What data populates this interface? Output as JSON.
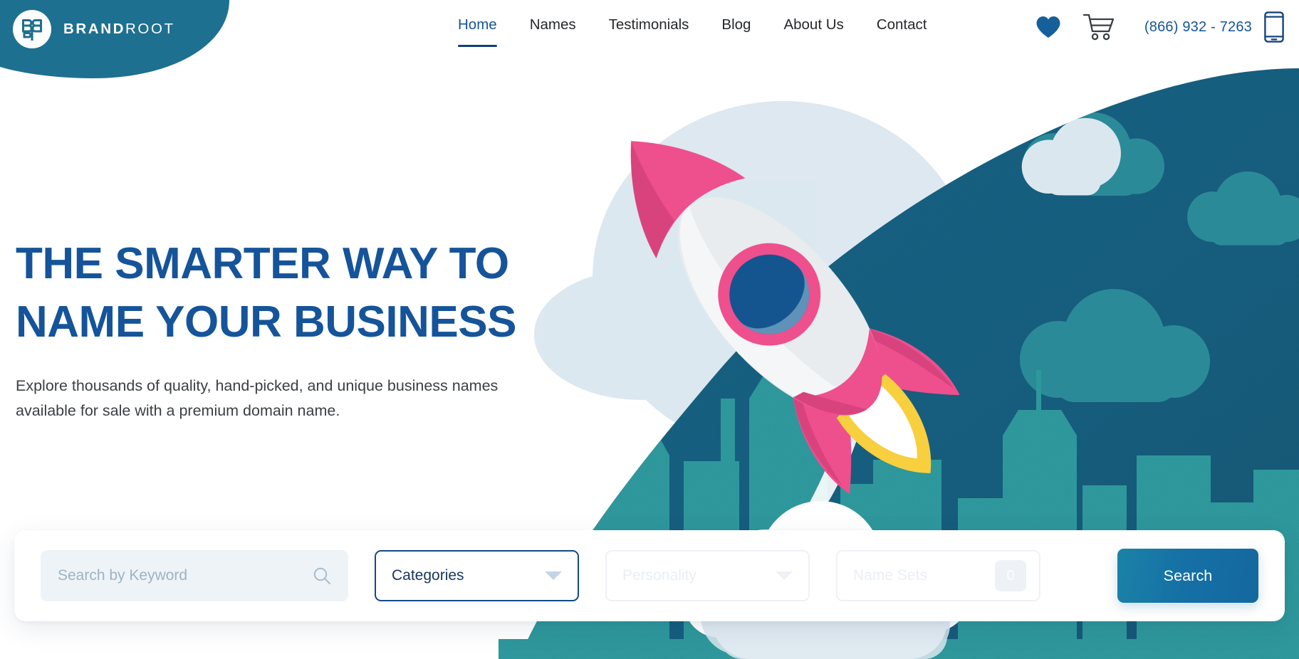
{
  "brand": {
    "name_bold": "BRAND",
    "name_light": "ROOT",
    "logo_icon": "brandroot-monogram-icon"
  },
  "nav": {
    "items": [
      {
        "label": "Home",
        "active": true
      },
      {
        "label": "Names",
        "active": false
      },
      {
        "label": "Testimonials",
        "active": false
      },
      {
        "label": "Blog",
        "active": false
      },
      {
        "label": "About Us",
        "active": false
      },
      {
        "label": "Contact",
        "active": false
      }
    ]
  },
  "header_actions": {
    "favorites_icon": "heart-icon",
    "cart_icon": "shopping-cart-icon",
    "phone": "(866) 932 - 7263",
    "mobile_icon": "mobile-phone-icon"
  },
  "hero": {
    "title": "THE SMARTER WAY TO NAME YOUR BUSINESS",
    "subtitle": "Explore thousands of quality, hand-picked, and unique business names available for sale with a premium domain name.",
    "illustration": "rocket-launching-over-city-skyline"
  },
  "search": {
    "keyword_placeholder": "Search by Keyword",
    "keyword_value": "",
    "search_icon": "magnifier-icon",
    "categories_label": "Categories",
    "categories_icon": "chevron-down-icon",
    "personality_label": "Personality",
    "personality_icon": "chevron-down-icon",
    "namesets_label": "Name Sets",
    "namesets_count": "0",
    "submit_label": "Search"
  },
  "colors": {
    "brand_blue": "#15549a",
    "deep_navy": "#16365f",
    "hero_navy": "#15607f",
    "hero_dark": "#1d5573",
    "teal": "#2a9aa0",
    "pink": "#ee4f8d",
    "yellow": "#f7cf3f",
    "button_gradient_start": "#1b82a6",
    "button_gradient_end": "#14689f"
  }
}
